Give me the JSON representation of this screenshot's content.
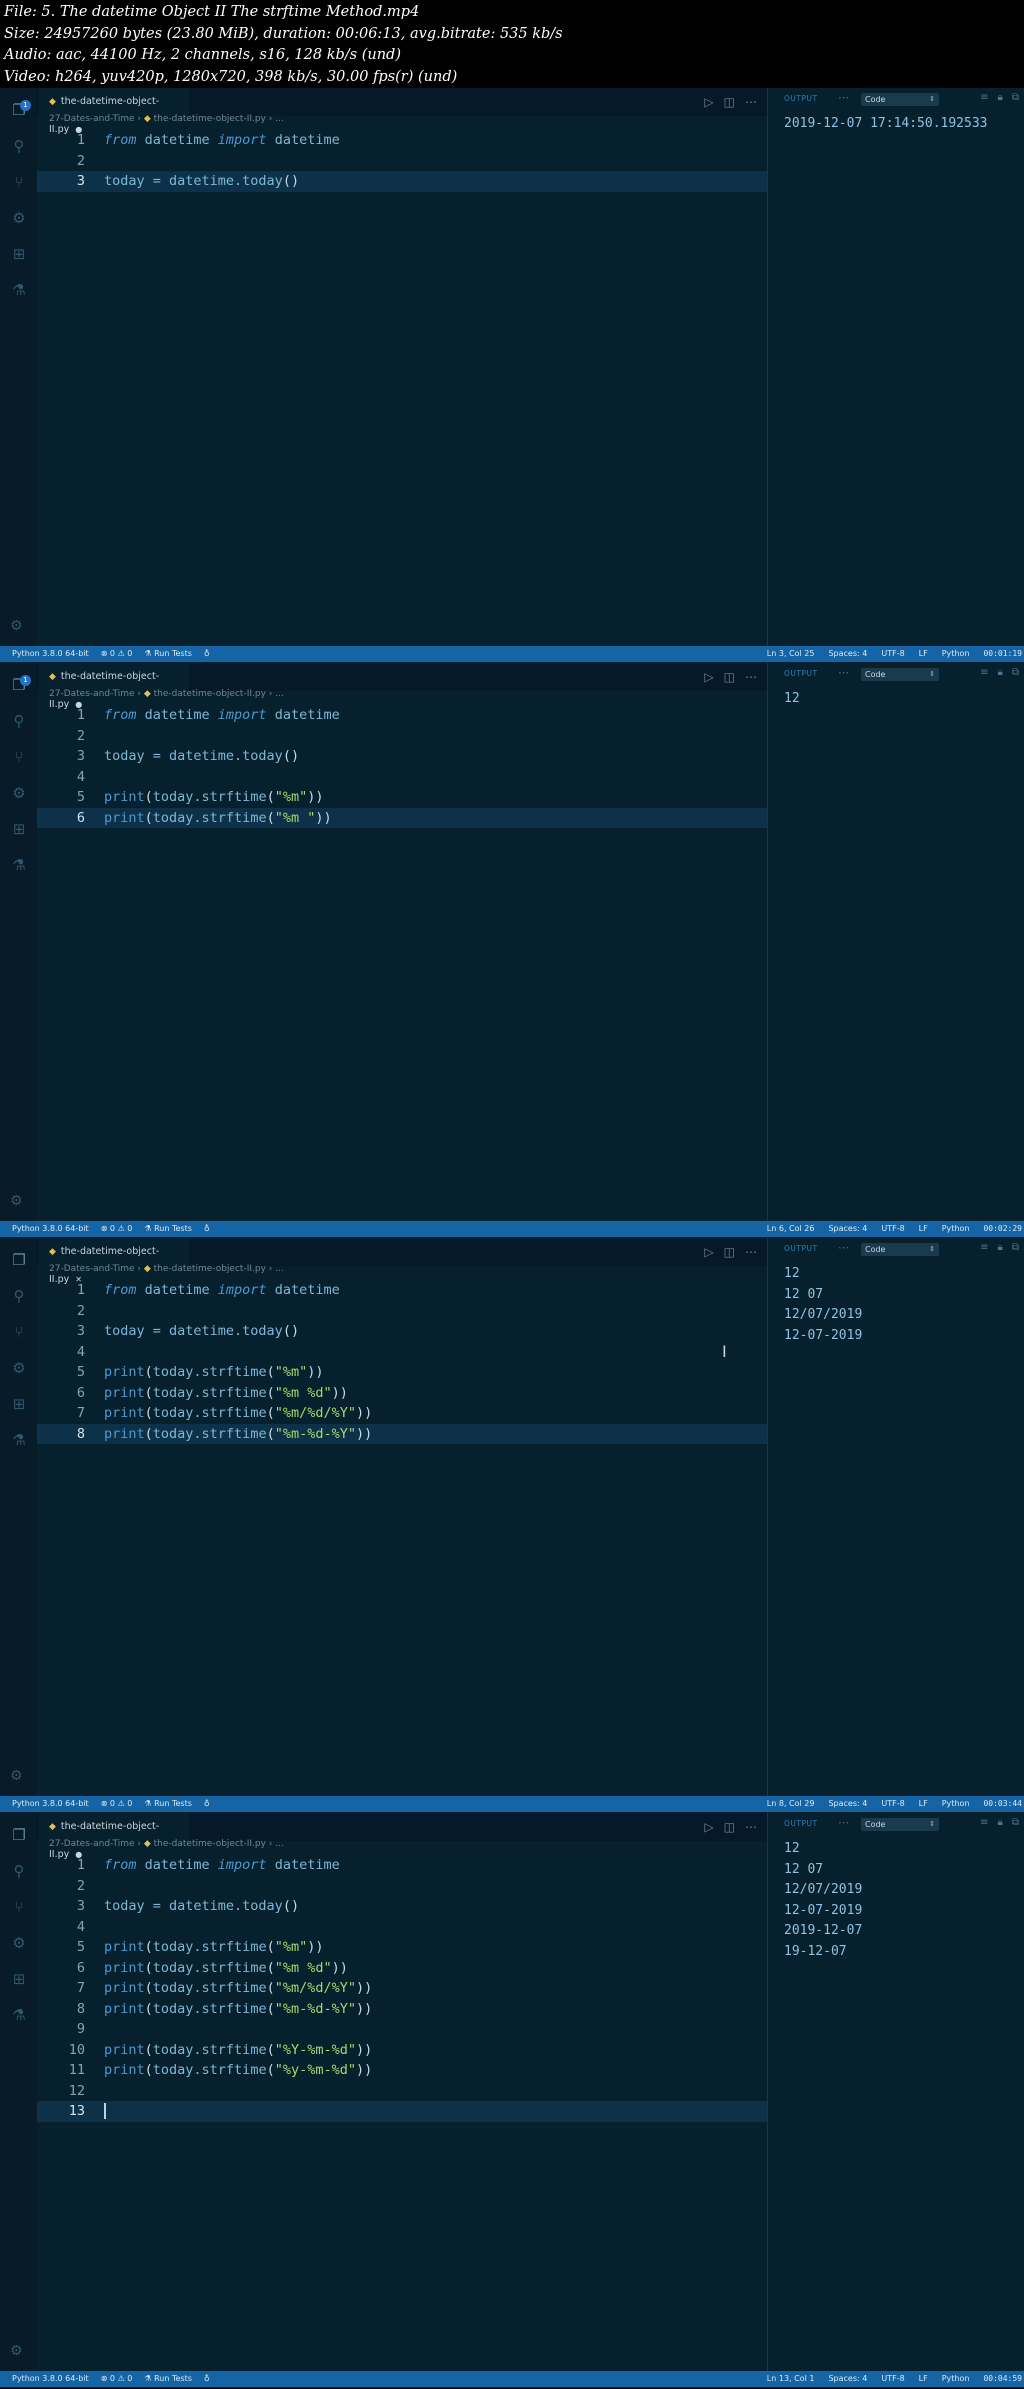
{
  "header": {
    "line1": "File: 5. The datetime Object II The strftime Method.mp4",
    "line2": "Size: 24957260 bytes (23.80 MiB), duration: 00:06:13, avg.bitrate: 535 kb/s",
    "line3": "Audio: aac, 44100 Hz, 2 channels, s16, 128 kb/s (und)",
    "line4": "Video: h264, yuv420p, 1280x720, 398 kb/s, 30.00 fps(r) (und)"
  },
  "frames": [
    {
      "tab_label": "the-datetime-object-II.py",
      "tab_indicator": "●",
      "crumb_folder": "27-Dates-and-Time",
      "crumb_file": "the-datetime-object-II.py",
      "crumb_more": "...",
      "lines": [
        [
          {
            "c": "k-it",
            "t": "from"
          },
          {
            "c": "",
            "t": " datetime "
          },
          {
            "c": "k-it",
            "t": "import"
          },
          {
            "c": "",
            "t": " datetime"
          }
        ],
        [],
        [
          {
            "c": "",
            "t": "today = datetime.today"
          },
          {
            "c": "p",
            "t": "()"
          }
        ]
      ],
      "cursor_line": 3,
      "output_label": "OUTPUT",
      "output_channel": "Code",
      "output_lines": [
        "2019-12-07 17:14:50.192533"
      ],
      "status_left": [
        "Python 3.8.0 64-bit",
        "⊗ 0 ⚠ 0",
        "⚗ Run Tests",
        "♁"
      ],
      "status_right": [
        "Ln 3, Col 25",
        "Spaces: 4",
        "UTF-8",
        "LF",
        "Python"
      ],
      "timestamp": "00:01:19"
    },
    {
      "tab_label": "the-datetime-object-II.py",
      "tab_indicator": "●",
      "crumb_folder": "27-Dates-and-Time",
      "crumb_file": "the-datetime-object-II.py",
      "crumb_more": "...",
      "lines": [
        [
          {
            "c": "k-it",
            "t": "from"
          },
          {
            "c": "",
            "t": " datetime "
          },
          {
            "c": "k-it",
            "t": "import"
          },
          {
            "c": "",
            "t": " datetime"
          }
        ],
        [],
        [
          {
            "c": "",
            "t": "today = datetime.today"
          },
          {
            "c": "p",
            "t": "()"
          }
        ],
        [],
        [
          {
            "c": "k",
            "t": "print"
          },
          {
            "c": "p",
            "t": "("
          },
          {
            "c": "",
            "t": "today.strftime"
          },
          {
            "c": "p",
            "t": "("
          },
          {
            "c": "s",
            "t": "\"%m\""
          },
          {
            "c": "p",
            "t": "))"
          }
        ],
        [
          {
            "c": "k",
            "t": "print"
          },
          {
            "c": "p",
            "t": "("
          },
          {
            "c": "",
            "t": "today.strftime"
          },
          {
            "c": "p",
            "t": "("
          },
          {
            "c": "s",
            "t": "\"%m \""
          },
          {
            "c": "p",
            "t": "))"
          }
        ]
      ],
      "cursor_line": 6,
      "output_label": "OUTPUT",
      "output_channel": "Code",
      "output_lines": [
        "12"
      ],
      "status_left": [
        "Python 3.8.0 64-bit",
        "⊗ 0 ⚠ 0",
        "⚗ Run Tests",
        "♁"
      ],
      "status_right": [
        "Ln 6, Col 26",
        "Spaces: 4",
        "UTF-8",
        "LF",
        "Python"
      ],
      "timestamp": "00:02:29"
    },
    {
      "tab_label": "the-datetime-object-II.py",
      "tab_indicator": "✕",
      "crumb_folder": "27-Dates-and-Time",
      "crumb_file": "the-datetime-object-II.py",
      "crumb_more": "...",
      "lines": [
        [
          {
            "c": "k-it",
            "t": "from"
          },
          {
            "c": "",
            "t": " datetime "
          },
          {
            "c": "k-it",
            "t": "import"
          },
          {
            "c": "",
            "t": " datetime"
          }
        ],
        [],
        [
          {
            "c": "",
            "t": "today = datetime.today"
          },
          {
            "c": "p",
            "t": "()"
          }
        ],
        [],
        [
          {
            "c": "k",
            "t": "print"
          },
          {
            "c": "p",
            "t": "("
          },
          {
            "c": "",
            "t": "today.strftime"
          },
          {
            "c": "p",
            "t": "("
          },
          {
            "c": "s",
            "t": "\"%m\""
          },
          {
            "c": "p",
            "t": "))"
          }
        ],
        [
          {
            "c": "k",
            "t": "print"
          },
          {
            "c": "p",
            "t": "("
          },
          {
            "c": "",
            "t": "today.strftime"
          },
          {
            "c": "p",
            "t": "("
          },
          {
            "c": "s",
            "t": "\"%m %d\""
          },
          {
            "c": "p",
            "t": "))"
          }
        ],
        [
          {
            "c": "k",
            "t": "print"
          },
          {
            "c": "p",
            "t": "("
          },
          {
            "c": "",
            "t": "today.strftime"
          },
          {
            "c": "p",
            "t": "("
          },
          {
            "c": "s",
            "t": "\"%m/%d/%Y\""
          },
          {
            "c": "p",
            "t": "))"
          }
        ],
        [
          {
            "c": "k",
            "t": "print"
          },
          {
            "c": "p",
            "t": "("
          },
          {
            "c": "",
            "t": "today.strftime"
          },
          {
            "c": "p",
            "t": "("
          },
          {
            "c": "s",
            "t": "\"%m-%d-%Y\""
          },
          {
            "c": "p",
            "t": "))"
          }
        ]
      ],
      "cursor_line": 8,
      "output_label": "OUTPUT",
      "output_channel": "Code",
      "output_lines": [
        "12",
        "12 07",
        "12/07/2019",
        "12-07-2019"
      ],
      "status_left": [
        "Python 3.8.0 64-bit",
        "⊗ 0 ⚠ 0",
        "⚗ Run Tests",
        "♁"
      ],
      "status_right": [
        "Ln 8, Col 29",
        "Spaces: 4",
        "UTF-8",
        "LF",
        "Python"
      ],
      "timestamp": "00:03:44"
    },
    {
      "tab_label": "the-datetime-object-II.py",
      "tab_indicator": "●",
      "crumb_folder": "27-Dates-and-Time",
      "crumb_file": "the-datetime-object-II.py",
      "crumb_more": "...",
      "lines": [
        [
          {
            "c": "k-it",
            "t": "from"
          },
          {
            "c": "",
            "t": " datetime "
          },
          {
            "c": "k-it",
            "t": "import"
          },
          {
            "c": "",
            "t": " datetime"
          }
        ],
        [],
        [
          {
            "c": "",
            "t": "today = datetime.today"
          },
          {
            "c": "p",
            "t": "()"
          }
        ],
        [],
        [
          {
            "c": "k",
            "t": "print"
          },
          {
            "c": "p",
            "t": "("
          },
          {
            "c": "",
            "t": "today.strftime"
          },
          {
            "c": "p",
            "t": "("
          },
          {
            "c": "s",
            "t": "\"%m\""
          },
          {
            "c": "p",
            "t": "))"
          }
        ],
        [
          {
            "c": "k",
            "t": "print"
          },
          {
            "c": "p",
            "t": "("
          },
          {
            "c": "",
            "t": "today.strftime"
          },
          {
            "c": "p",
            "t": "("
          },
          {
            "c": "s",
            "t": "\"%m %d\""
          },
          {
            "c": "p",
            "t": "))"
          }
        ],
        [
          {
            "c": "k",
            "t": "print"
          },
          {
            "c": "p",
            "t": "("
          },
          {
            "c": "",
            "t": "today.strftime"
          },
          {
            "c": "p",
            "t": "("
          },
          {
            "c": "s",
            "t": "\"%m/%d/%Y\""
          },
          {
            "c": "p",
            "t": "))"
          }
        ],
        [
          {
            "c": "k",
            "t": "print"
          },
          {
            "c": "p",
            "t": "("
          },
          {
            "c": "",
            "t": "today.strftime"
          },
          {
            "c": "p",
            "t": "("
          },
          {
            "c": "s",
            "t": "\"%m-%d-%Y\""
          },
          {
            "c": "p",
            "t": "))"
          }
        ],
        [],
        [
          {
            "c": "k",
            "t": "print"
          },
          {
            "c": "p",
            "t": "("
          },
          {
            "c": "",
            "t": "today.strftime"
          },
          {
            "c": "p",
            "t": "("
          },
          {
            "c": "s",
            "t": "\"%Y-%m-%d\""
          },
          {
            "c": "p",
            "t": "))"
          }
        ],
        [
          {
            "c": "k",
            "t": "print"
          },
          {
            "c": "p",
            "t": "("
          },
          {
            "c": "",
            "t": "today.strftime"
          },
          {
            "c": "p",
            "t": "("
          },
          {
            "c": "s",
            "t": "\"%y-%m-%d\""
          },
          {
            "c": "p",
            "t": "))"
          }
        ],
        [],
        []
      ],
      "cursor_line": 13,
      "output_label": "OUTPUT",
      "output_channel": "Code",
      "output_lines": [
        "12",
        "12 07",
        "12/07/2019",
        "12-07-2019",
        "2019-12-07",
        "19-12-07"
      ],
      "status_left": [
        "Python 3.8.0 64-bit",
        "⊗ 0 ⚠ 0",
        "⚗ Run Tests",
        "♁"
      ],
      "status_right": [
        "Ln 13, Col 1",
        "Spaces: 4",
        "UTF-8",
        "LF",
        "Python"
      ],
      "timestamp": "00:04:59"
    }
  ],
  "icons": {
    "activity": [
      "files-icon",
      "search-icon",
      "source-control-icon",
      "debug-icon",
      "extensions-icon",
      "test-flask-icon"
    ],
    "editor_toolbar": [
      "run-icon",
      "split-editor-icon",
      "more-actions-icon"
    ],
    "output_toolbar": [
      "clear-output-icon",
      "lock-scroll-icon",
      "maximize-panel-icon"
    ]
  },
  "colors": {
    "editor_bg": "#07202e",
    "status_bar": "#1565a6",
    "keyword": "#4b9ad1",
    "string": "#a8d86f",
    "identifier": "#7eb7d6"
  }
}
